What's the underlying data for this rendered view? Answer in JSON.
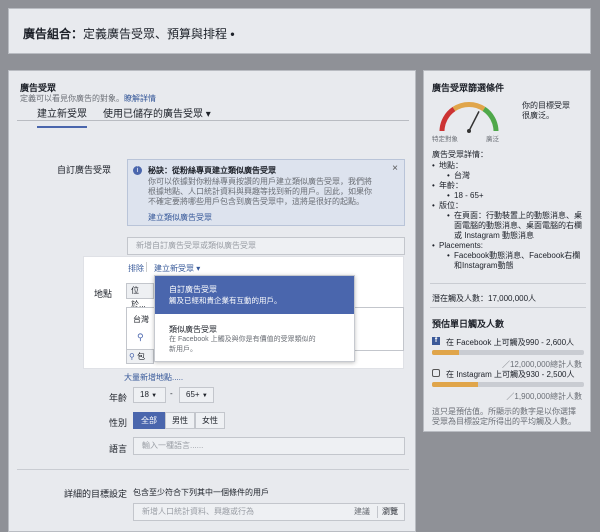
{
  "header": {
    "title_bold": "廣告組合：",
    "title_rest": "定義廣告受眾、預算與排程",
    "dot": "•"
  },
  "audience": {
    "title": "廣告受眾",
    "desc": "定義可以看見你廣告的對象。",
    "learn_more": "瞭解詳情",
    "tabs": [
      {
        "label": "建立新受眾"
      },
      {
        "label": "使用已儲存的廣告受眾 ▾"
      }
    ],
    "custom": {
      "label": "自訂廣告受眾",
      "info_title": "秘訣：從粉絲專頁建立類似廣告受眾",
      "info_lines": [
        "你可以依據對你粉絲專頁按讚的用戶建立類似廣告受眾，我們將",
        "根據地點、人口統計資料與興趣等找到新的用戶。因此，如果你",
        "不確定要將哪些用戶包含到廣告受眾中，這將是很好的起點。"
      ],
      "info_link": "建立類似廣告受眾",
      "input_placeholder": "新增自訂廣告受眾或類似廣告受眾"
    },
    "remove": "排除",
    "create_new": "建立新受眾 ▾",
    "menu": [
      {
        "title": "自訂廣告受眾",
        "desc": "觸及已經和貴企業有互動的用戶。"
      },
      {
        "title": "類似廣告受眾",
        "desc1": "在 Facebook 上觸及與你是有價值的受眾類似的",
        "desc2": "新用戶。"
      }
    ],
    "location": {
      "label": "地點",
      "dropdown": "位於...",
      "country": "台灣",
      "pin_text": "包",
      "bulk_link": "大量新增地點....."
    },
    "age": {
      "label": "年齡",
      "min": "18",
      "max": "65+",
      "dash": "-"
    },
    "gender": {
      "label": "性別",
      "options": [
        "全部",
        "男性",
        "女性"
      ]
    },
    "language": {
      "label": "語言",
      "placeholder": "輸入一種語言......"
    },
    "detailed": {
      "label": "詳細的目標設定",
      "text": "包含至少符合下列其中一個條件的用戶",
      "placeholder": "新增人口統計資料、興趣或行為",
      "suggest": "建議",
      "browse": "瀏覽"
    }
  },
  "sidebar": {
    "title": "廣告受眾篩選條件",
    "gauge_left": "特定對象",
    "gauge_right": "廣泛",
    "gauge_level": 0.65,
    "gauge_text": [
      "你的目標受眾",
      "很廣泛。"
    ],
    "details_title": "廣告受眾詳情：",
    "details": [
      {
        "label": "地點：",
        "sub": [
          "台灣"
        ]
      },
      {
        "label": "年齡：",
        "sub": [
          "18 - 65+"
        ]
      },
      {
        "label": "版位：",
        "sub": [
          "在頁面：行動裝置上的動態消息、桌面電腦的動態消息、桌面電腦的右欄或 Instagram 動態消息"
        ]
      },
      {
        "label": "Placements:",
        "sub": [
          "Facebook動態消息、Facebook右欄和Instagram動態"
        ]
      }
    ],
    "reach_label": "潛在觸及人數：",
    "reach_value": "17,000,000人",
    "daily_title": "預估單日觸及人數",
    "facebook": {
      "label": "在 Facebook 上可觸及990 - 2,600人",
      "total": "／12,000,000總計人數",
      "fill": 0.18
    },
    "instagram": {
      "label": "在 Instagram 上可觸及930 - 2,500人",
      "total": "／1,900,000總計人數",
      "fill": 0.3
    },
    "note": [
      "這只是預估值。所顯示的數字是以你選擇",
      "受眾為目標設定所得出的平均觸及人數。"
    ]
  },
  "colors": {
    "accent": "#4a66ad",
    "gauge_red": "#c33",
    "gauge_yellow": "#e0a54a",
    "gauge_green": "#4fa84a"
  }
}
